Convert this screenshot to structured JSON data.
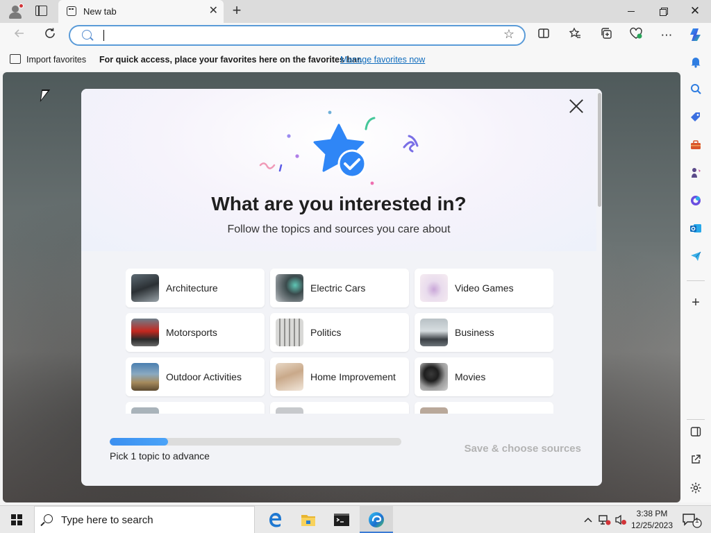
{
  "browser": {
    "tab_title": "New tab",
    "address_value": "",
    "favorites_bar": {
      "import_label": "Import favorites",
      "message": "For quick access, place your favorites here on the favorites bar.",
      "manage_link": "Manage favorites now"
    }
  },
  "dialog": {
    "title": "What are you interested in?",
    "subtitle": "Follow the topics and sources you care about",
    "topics": [
      {
        "label": "Architecture",
        "icon": "architecture-thumbnail"
      },
      {
        "label": "Electric Cars",
        "icon": "electric-cars-thumbnail"
      },
      {
        "label": "Video Games",
        "icon": "video-games-thumbnail"
      },
      {
        "label": "Motorsports",
        "icon": "motorsports-thumbnail"
      },
      {
        "label": "Politics",
        "icon": "politics-thumbnail"
      },
      {
        "label": "Business",
        "icon": "business-thumbnail"
      },
      {
        "label": "Outdoor Activities",
        "icon": "outdoor-activities-thumbnail"
      },
      {
        "label": "Home Improvement",
        "icon": "home-improvement-thumbnail"
      },
      {
        "label": "Movies",
        "icon": "movies-thumbnail"
      }
    ],
    "progress_fraction": 0.2,
    "progress_label": "Pick 1 topic to advance",
    "save_button": "Save & choose sources"
  },
  "taskbar": {
    "search_placeholder": "Type here to search",
    "time": "3:38 PM",
    "date": "12/25/2023",
    "notification_count": "1"
  },
  "colors": {
    "accent": "#0f6cbd",
    "progress": "#3b8ff0",
    "star": "#2f86f6"
  }
}
